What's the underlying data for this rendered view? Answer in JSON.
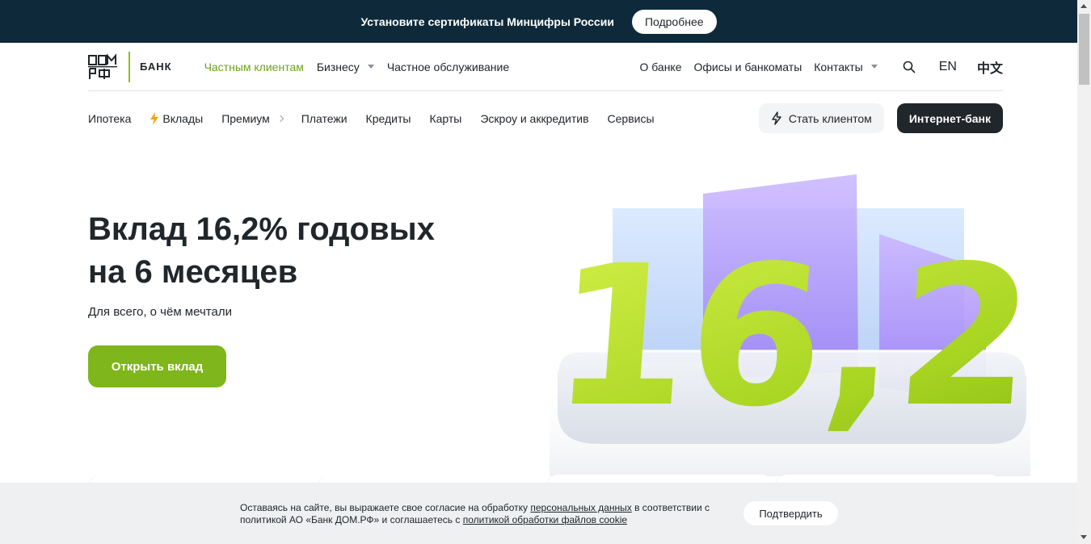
{
  "notice": {
    "text": "Установите сертификаты Минцифры России",
    "button": "Подробнее"
  },
  "logo": {
    "bank_label": "БАНК"
  },
  "header": {
    "nav_left": [
      {
        "label": "Частным клиентам",
        "active": true
      },
      {
        "label": "Бизнесу",
        "dropdown": true
      },
      {
        "label": "Частное обслуживание"
      }
    ],
    "nav_right": [
      {
        "label": "О банке"
      },
      {
        "label": "Офисы и банкоматы"
      },
      {
        "label": "Контакты",
        "dropdown": true
      }
    ],
    "lang_en": "EN",
    "lang_cn": "中文"
  },
  "subnav": {
    "items": [
      {
        "label": "Ипотека"
      },
      {
        "label": "Вклады",
        "icon": "lightning-icon"
      },
      {
        "label": "Премиум",
        "chevron": true
      },
      {
        "label": "Платежи"
      },
      {
        "label": "Кредиты"
      },
      {
        "label": "Карты"
      },
      {
        "label": "Эскроу и аккредитив"
      },
      {
        "label": "Сервисы"
      }
    ],
    "become_client": "Стать клиентом",
    "internet_bank": "Интернет-банк"
  },
  "hero": {
    "title_line1": "Вклад 16,2% годовых",
    "title_line2": "на 6 месяцев",
    "subtitle": "Для всего, о чём мечтали",
    "button": "Открыть вклад",
    "image_text": "16,2%"
  },
  "cookie": {
    "text_1": "Оставаясь на сайте, вы выражаете свое согласие на обработку ",
    "link_1": "персональных данных",
    "text_2": " в соответствии с политикой АО «Банк ДОМ.РФ» и соглашаетесь с ",
    "link_2": "политикой обработки файлов cookie",
    "button": "Подтвердить"
  },
  "colors": {
    "notice_bg": "#0e2a3a",
    "brand_green": "#7eb61b",
    "active_nav": "#6ea316",
    "dark": "#21262b"
  }
}
